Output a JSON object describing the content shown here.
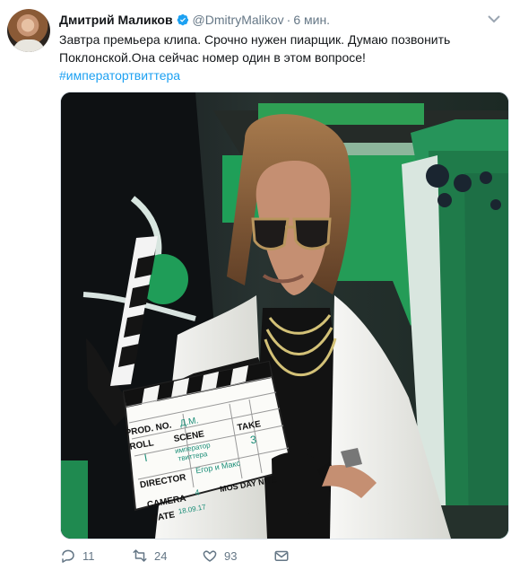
{
  "tweet": {
    "author_name": "Дмитрий Маликов",
    "author_handle": "@DmitryMalikov",
    "separator": "·",
    "timestamp": "6 мин.",
    "text_lines": [
      "Завтра премьера клипа. Срочно нужен пиарщик. Думаю позвонить",
      "Поклонской.Она сейчас номер один в этом вопросе!"
    ],
    "hashtag": "#императортвиттера"
  },
  "clapperboard": {
    "prod_no_label": "PROD. NO.",
    "prod_no_value": "Д.М.",
    "roll_label": "ROLL",
    "scene_label": "SCENE",
    "take_label": "TAKE",
    "roll_value": "I",
    "scene_value_1": "император",
    "scene_value_2": "твиттера",
    "take_value": "3",
    "director_label": "DIRECTOR",
    "director_value": "Егор и Макс",
    "camera_label": "CAMERA",
    "camera_value": "4",
    "mos_day_nite": "MOS DAY NITE",
    "date_label": "DATE",
    "date_value": "18.09.17"
  },
  "actions": {
    "reply_count": "11",
    "retweet_count": "24",
    "like_count": "93"
  },
  "colors": {
    "link": "#1da1f2",
    "verified": "#1da1f2",
    "meta_gray": "#657786"
  }
}
